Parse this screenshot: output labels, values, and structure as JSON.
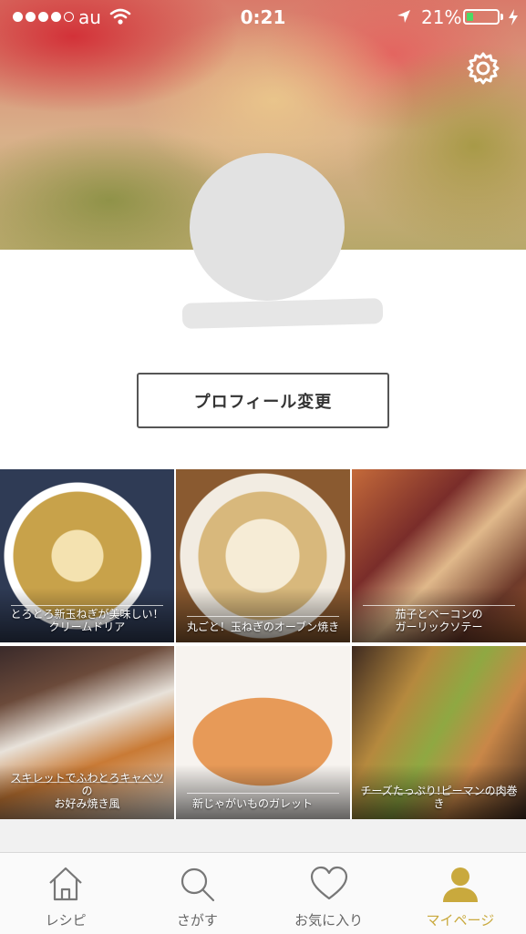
{
  "status_bar": {
    "carrier": "au",
    "time": "0:21",
    "battery_percent": "21%",
    "battery_level": 0.21
  },
  "profile": {
    "edit_button": "プロフィール変更"
  },
  "recipes": [
    {
      "caption_l1": "とろとろ新玉ねぎが美味しい！",
      "caption_l2": "クリームドリア"
    },
    {
      "caption_l1": "丸ごと！玉ねぎのオーブン焼き",
      "caption_l2": ""
    },
    {
      "caption_l1": "茄子とベーコンの",
      "caption_l2": "ガーリックソテー"
    },
    {
      "caption_l1": "スキレットでふわとろキャベツの",
      "caption_l2": "お好み焼き風"
    },
    {
      "caption_l1": "新じゃがいものガレット",
      "caption_l2": ""
    },
    {
      "caption_l1": "チーズたっぷり!ピーマンの肉巻き",
      "caption_l2": ""
    }
  ],
  "tabs": [
    {
      "label": "レシピ",
      "icon": "home-icon"
    },
    {
      "label": "さがす",
      "icon": "search-icon"
    },
    {
      "label": "お気に入り",
      "icon": "heart-icon"
    },
    {
      "label": "マイページ",
      "icon": "person-icon",
      "active": true
    }
  ],
  "colors": {
    "accent": "#c9a93d",
    "battery_green": "#4cd964"
  }
}
